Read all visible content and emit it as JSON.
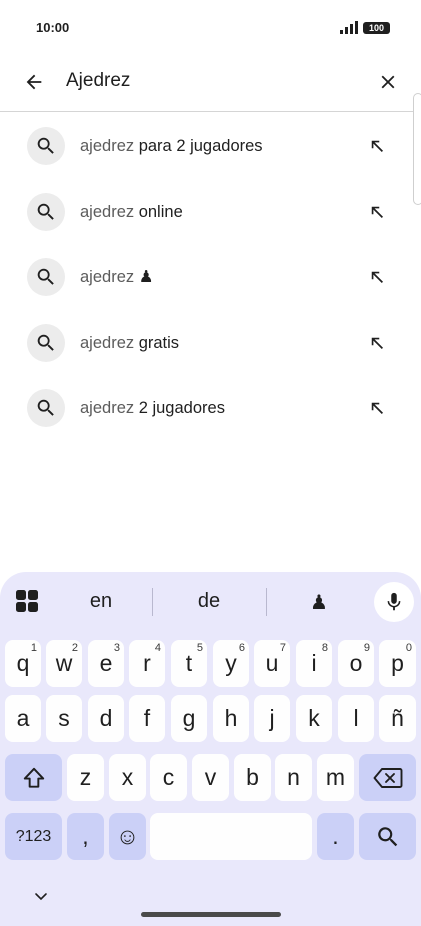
{
  "status_bar": {
    "time": "10:00",
    "battery": "100"
  },
  "search": {
    "query": "Ajedrez"
  },
  "suggestions": [
    {
      "query_part": "ajedrez",
      "rest": " para 2 jugadores"
    },
    {
      "query_part": "ajedrez",
      "rest": " online"
    },
    {
      "query_part": "ajedrez",
      "rest": " ♟"
    },
    {
      "query_part": "ajedrez",
      "rest": " gratis"
    },
    {
      "query_part": "ajedrez",
      "rest": " 2 jugadores"
    }
  ],
  "keyboard": {
    "suggestions": [
      "en",
      "de",
      "♟"
    ],
    "row1": [
      {
        "key": "q",
        "hint": "1"
      },
      {
        "key": "w",
        "hint": "2"
      },
      {
        "key": "e",
        "hint": "3"
      },
      {
        "key": "r",
        "hint": "4"
      },
      {
        "key": "t",
        "hint": "5"
      },
      {
        "key": "y",
        "hint": "6"
      },
      {
        "key": "u",
        "hint": "7"
      },
      {
        "key": "i",
        "hint": "8"
      },
      {
        "key": "o",
        "hint": "9"
      },
      {
        "key": "p",
        "hint": "0"
      }
    ],
    "row2": [
      "a",
      "s",
      "d",
      "f",
      "g",
      "h",
      "j",
      "k",
      "l",
      "ñ"
    ],
    "row3": [
      "z",
      "x",
      "c",
      "v",
      "b",
      "n",
      "m"
    ],
    "symbols_label": "?123",
    "comma": ",",
    "emoji": "☺",
    "period": "."
  },
  "colors": {
    "keyboard_bg": "#e9e8fb",
    "modifier_key": "#cbd0f7",
    "key": "#fefefe"
  }
}
